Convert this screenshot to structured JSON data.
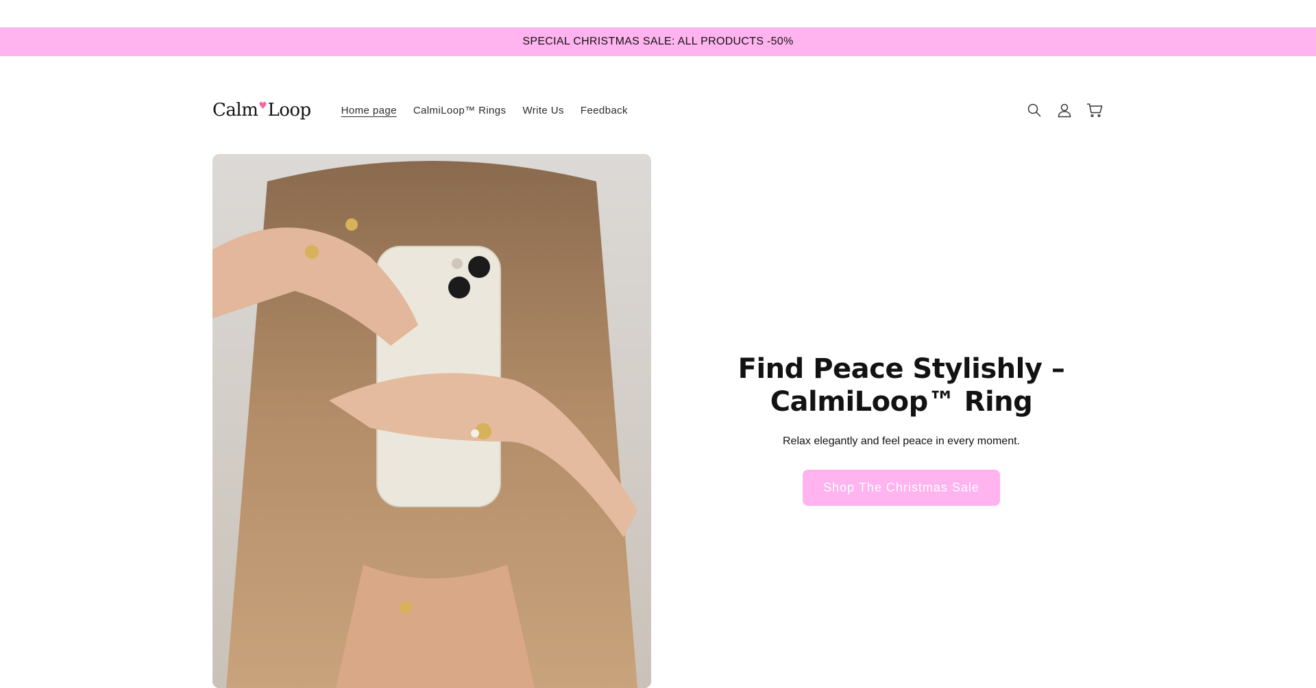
{
  "announcement": {
    "text": "SPECIAL CHRISTMAS SALE: ALL PRODUCTS -50%",
    "bg_color": "#ffb3ef"
  },
  "header": {
    "logo": {
      "text_left": "Calm",
      "text_right": "Loop",
      "heart_glyph": "♥"
    },
    "nav": [
      {
        "label": "Home page",
        "active": true
      },
      {
        "label": "CalmiLoop™ Rings",
        "active": false
      },
      {
        "label": "Write Us",
        "active": false
      },
      {
        "label": "Feedback",
        "active": false
      }
    ],
    "icons": [
      "search-icon",
      "account-icon",
      "cart-icon"
    ]
  },
  "hero": {
    "title": "Find Peace Stylishly – CalmiLoop™ Ring",
    "subtitle": "Relax elegantly and feel peace in every moment.",
    "button_label": "Shop The Christmas Sale",
    "button_color": "#ffb3ef"
  }
}
